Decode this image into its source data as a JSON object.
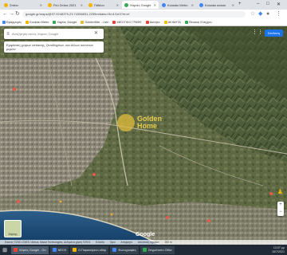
{
  "browser": {
    "tabs": [
      {
        "label": "Σπίτια",
        "color": "#f4b400",
        "active": false
      },
      {
        "label": "Ρεύ Σπίτια 2021",
        "color": "#f4b400",
        "active": false
      },
      {
        "label": "Πιθάνα",
        "color": "#f4b400",
        "active": false
      },
      {
        "label": "Χάρτες Google",
        "color": "#34a853",
        "active": true
      },
      {
        "label": "Κουκάκι Metro",
        "color": "#4285f4",
        "active": false
      },
      {
        "label": "Κουκάκι κατοικ",
        "color": "#4285f4",
        "active": false
      }
    ],
    "url": "google.gr/maps/@37.9248379,23.74356831,2255m/data=!3m1!1e3?hl=el",
    "bookmarks": [
      {
        "label": "Εφαρμογές",
        "color": "#4285f4"
      },
      {
        "label": "Κουκάκι Metro",
        "color": "#f4b400"
      },
      {
        "label": "Χάρτες Google",
        "color": "#34a853"
      },
      {
        "label": "GoldenSite - Livin",
        "color": "#e2be3c"
      },
      {
        "label": "ΜΕΣΙΤΙΚΟ ΓΡΑΦΕ",
        "color": "#ea4335"
      },
      {
        "label": "Ακίνητα",
        "color": "#ea4335"
      },
      {
        "label": "ΑΚΙΝΗΤΑ",
        "color": "#fbbc04"
      },
      {
        "label": "Πίνακας Ελέγχου",
        "color": "#34a853"
      }
    ]
  },
  "map": {
    "search_placeholder": "Αναζήτηση στους Χάρτες Google",
    "hint_text": "Εμφάνιση χώρων εστίασης, ξενοδοχείων, και άλλων κοντινών μερών",
    "sign_in_label": "Σύνδεση",
    "logo_line1": "Golden",
    "logo_line2": "Home",
    "layers_label": "Χάρτης",
    "watermark": "Google",
    "footer": {
      "imagery": "Εικόνες ©2021 CNES / Airbus, Maxar Technologies, Δεδομένα χάρτη ©2021",
      "country": "Ελλάδα",
      "terms": "Όροι",
      "privacy": "Απόρρητο",
      "feedback": "Αποστολή σχολίων",
      "scale": "200 m"
    }
  },
  "taskbar": {
    "tasks": [
      {
        "label": "Χάρτες Google - Go",
        "active": true,
        "color": "#ea4335"
      },
      {
        "label": "ΝΕΟ3",
        "active": false,
        "color": "#4285f4"
      },
      {
        "label": "Ο.Παρακείμενο αδόμ",
        "active": false,
        "color": "#f4b400"
      },
      {
        "label": "Φωτογραφίες",
        "active": false,
        "color": "#4285f4"
      },
      {
        "label": "Στιγμιότυπο Οθόν",
        "active": false,
        "color": "#34a853"
      }
    ],
    "time": "13:07 μμ",
    "date": "16/7/2021"
  }
}
